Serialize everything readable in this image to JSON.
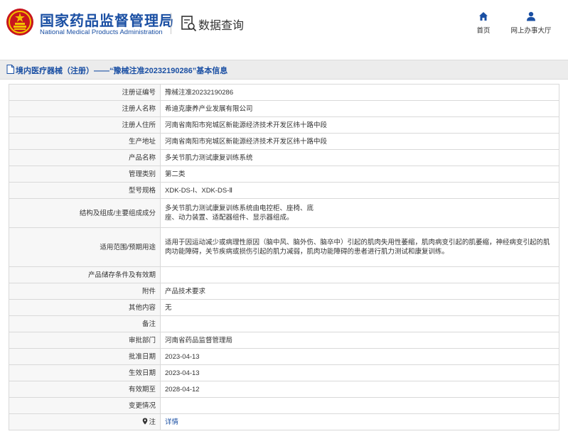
{
  "header": {
    "org_cn": "国家药品监督管理局",
    "org_en": "National Medical Products Administration",
    "section": "数据查询",
    "nav_home": "首页",
    "nav_hall": "网上办事大厅",
    "brand_color": "#1a4fa3"
  },
  "page_title": "境内医疗器械（注册）——“豫械注准20232190286”基本信息",
  "rows": [
    {
      "label": "注册证编号",
      "value": "豫械注准20232190286"
    },
    {
      "label": "注册人名称",
      "value": "希迪克康养产业发展有限公司"
    },
    {
      "label": "注册人住所",
      "value": "河南省南阳市宛城区新能源经济技术开发区纬十路中段"
    },
    {
      "label": "生产地址",
      "value": "河南省南阳市宛城区新能源经济技术开发区纬十路中段"
    },
    {
      "label": "产品名称",
      "value": "多关节肌力测试康复训练系统"
    },
    {
      "label": "管理类别",
      "value": "第二类"
    },
    {
      "label": "型号规格",
      "value": "XDK-DS-Ⅰ、XDK-DS-Ⅱ"
    },
    {
      "label": "结构及组成/主要组成成分",
      "value": "多关节肌力测试康复训练系统由电控柜、座椅、底座、动力装置、适配器组件、显示器组成。"
    },
    {
      "label": "适用范围/预期用途",
      "value": "适用于因运动减少或病理性原因（脑中风、脑外伤、脑卒中）引起的肌肉失用性萎缩，肌肉病变引起的肌萎缩，神经病变引起的肌肉功能障碍，关节疾病或损伤引起的肌力减弱，肌肉功能障碍的患者进行肌力测试和康复训练。"
    },
    {
      "label": "产品储存条件及有效期",
      "value": ""
    },
    {
      "label": "附件",
      "value": "产品技术要求"
    },
    {
      "label": "其他内容",
      "value": "无"
    },
    {
      "label": "备注",
      "value": ""
    },
    {
      "label": "审批部门",
      "value": "河南省药品监督管理局"
    },
    {
      "label": "批准日期",
      "value": "2023-04-13"
    },
    {
      "label": "生效日期",
      "value": "2023-04-13"
    },
    {
      "label": "有效期至",
      "value": "2028-04-12"
    },
    {
      "label": "变更情况",
      "value": ""
    },
    {
      "label": "注",
      "value": "详情"
    }
  ]
}
